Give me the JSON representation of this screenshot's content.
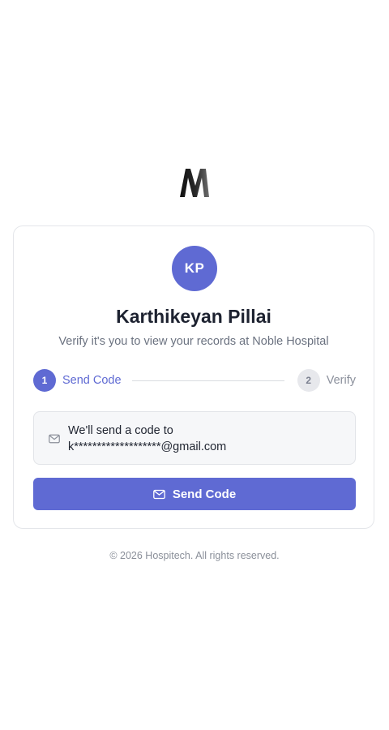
{
  "brand": {
    "logo_icon": "brand-m-logo-icon"
  },
  "profile": {
    "initials": "KP",
    "name": "Karthikeyan Pillai",
    "subtitle": "Verify it's you to view your records at Noble Hospital",
    "avatar_color": "#5f6ad3"
  },
  "steps": [
    {
      "number": "1",
      "label": "Send Code",
      "state": "active"
    },
    {
      "number": "2",
      "label": "Verify",
      "state": "inactive"
    }
  ],
  "info": {
    "icon": "mail-icon",
    "line1": "We'll send a code to",
    "line2": "k*******************@gmail.com"
  },
  "send_button": {
    "icon": "mail-icon",
    "label": "Send Code"
  },
  "footer": {
    "text": "© 2026 Hospitech. All rights reserved."
  },
  "colors": {
    "accent": "#5f6ad3",
    "muted_text": "#6b7280",
    "border": "#e4e6ea"
  }
}
